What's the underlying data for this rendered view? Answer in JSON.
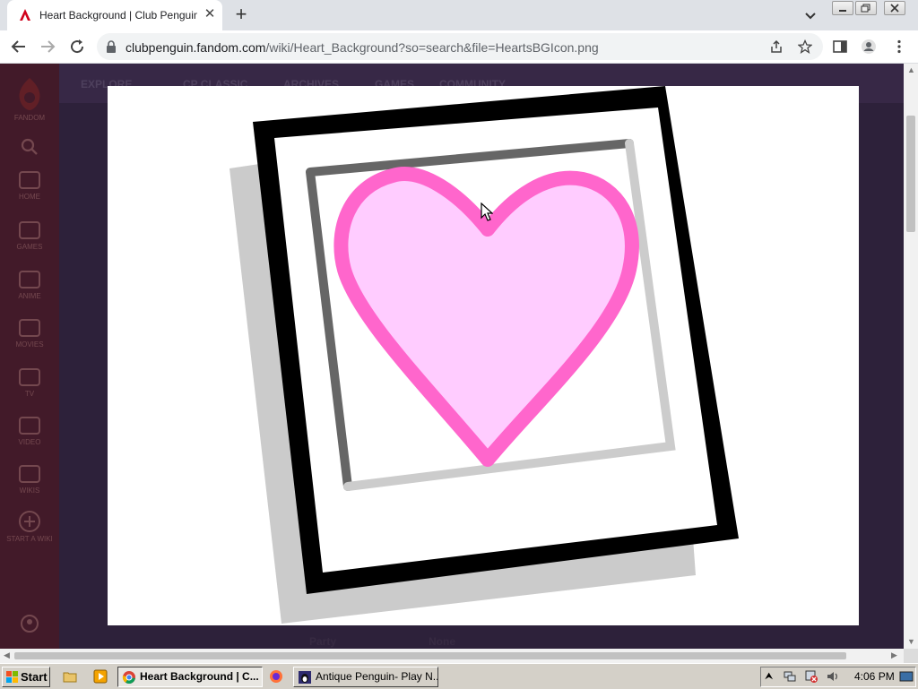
{
  "browser": {
    "tab": {
      "title": "Heart Background | Club Penguin W",
      "close_glyph": "✕"
    },
    "new_tab_glyph": "+",
    "address": {
      "domain": "clubpenguin.fandom.com",
      "path": "/wiki/Heart_Background?so=search&file=HeartsBGIcon.png"
    }
  },
  "background_page": {
    "top_nav": [
      "EXPLORE",
      "CP CLASSIC",
      "ARCHIVES",
      "GAMES",
      "COMMUNITY"
    ],
    "side_rail": [
      "FANDOM",
      "HOME",
      "GAMES",
      "ANIME",
      "MOVIES",
      "TV",
      "VIDEO",
      "WIKIS",
      "START A WIKI"
    ],
    "bottom_labels": [
      "Party",
      "None"
    ]
  },
  "lightbox": {
    "image_subject": "heart-background-icon",
    "colors": {
      "frame": "#000000",
      "shadow": "#cbcbcb",
      "inner_border_dark": "#666666",
      "inner_border_light": "#cccccc",
      "heart_outline": "#ff66cc",
      "heart_fill": "#ffccff"
    }
  },
  "taskbar": {
    "start_label": "Start",
    "tasks": [
      {
        "label": "Heart Background | C...",
        "active": true
      },
      {
        "label": "Antique Penguin- Play N...",
        "active": false
      }
    ],
    "clock": "4:06 PM"
  }
}
